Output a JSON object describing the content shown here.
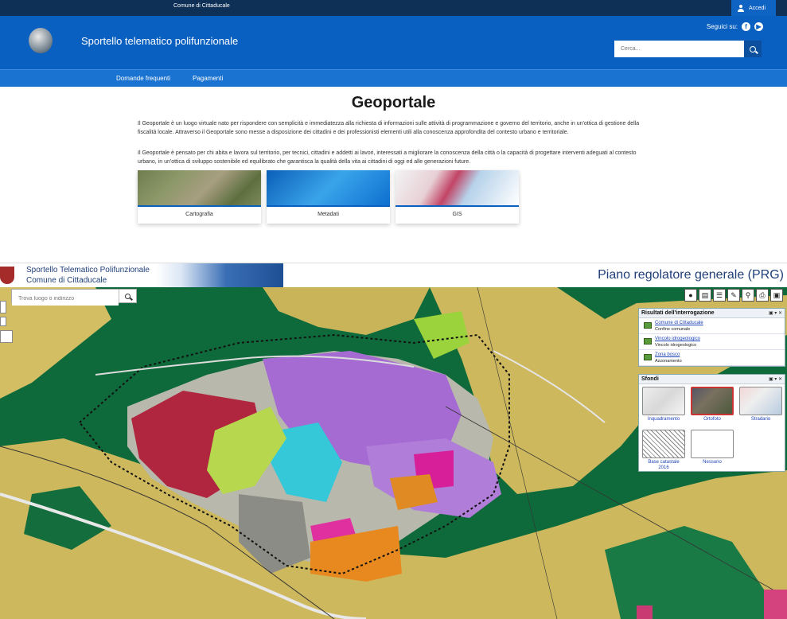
{
  "topbar": {
    "brand": "Comune di Cittaducale",
    "login_label": "Accedi"
  },
  "header": {
    "site_title": "Sportello telematico polifunzionale",
    "social_label": "Seguici su:",
    "search_placeholder": "Cerca..."
  },
  "nav": {
    "items": [
      "Domande frequenti",
      "Pagamenti"
    ]
  },
  "content": {
    "title": "Geoportale",
    "paragraphs": [
      "Il Geoportale è un luogo virtuale nato per rispondere con semplicità e immediatezza alla richiesta di informazioni sulle attività di programmazione e governo del territorio, anche in un'ottica di gestione della fiscalità locale. Attraverso il Geoportale sono messe a disposizione dei cittadini e dei professionisti elementi utili alla conoscenza approfondita del contesto urbano e territoriale.",
      "Il Geoportale è pensato per chi abita e lavora sul territorio, per tecnici, cittadini e addetti ai lavori, interessati a migliorare la conoscenza della città o la capacità di progettare interventi adeguati al contesto urbano, in un'ottica di sviluppo sostenibile ed equilibrato che garantisca la qualità della vita ai cittadini di oggi ed alle generazioni future."
    ],
    "cards": [
      "Cartografia",
      "Metadati",
      "GIS"
    ]
  },
  "map_header": {
    "logo_line1": "Sportello Telematico Polifunzionale",
    "logo_line2": "Comune di Cittaducale",
    "title": "Piano regolatore generale (PRG)"
  },
  "map": {
    "search_placeholder": "Trova luogo o indirizzo",
    "results_panel": {
      "title": "Risultati dell'interrogazione",
      "items": [
        {
          "link": "Comune di Cittaducale",
          "sub": "Confine comunale"
        },
        {
          "link": "Vincolo idrogeologico",
          "sub": "Vincolo idrogeologico"
        },
        {
          "link": "Zona bosco",
          "sub": "Azzonamento"
        }
      ]
    },
    "backgrounds_panel": {
      "title": "Sfondi",
      "items": [
        "Inquadramento",
        "Ortofoto",
        "Stradario",
        "Base catastale 2016",
        "Nessuno"
      ],
      "selected": "Ortofoto"
    }
  }
}
